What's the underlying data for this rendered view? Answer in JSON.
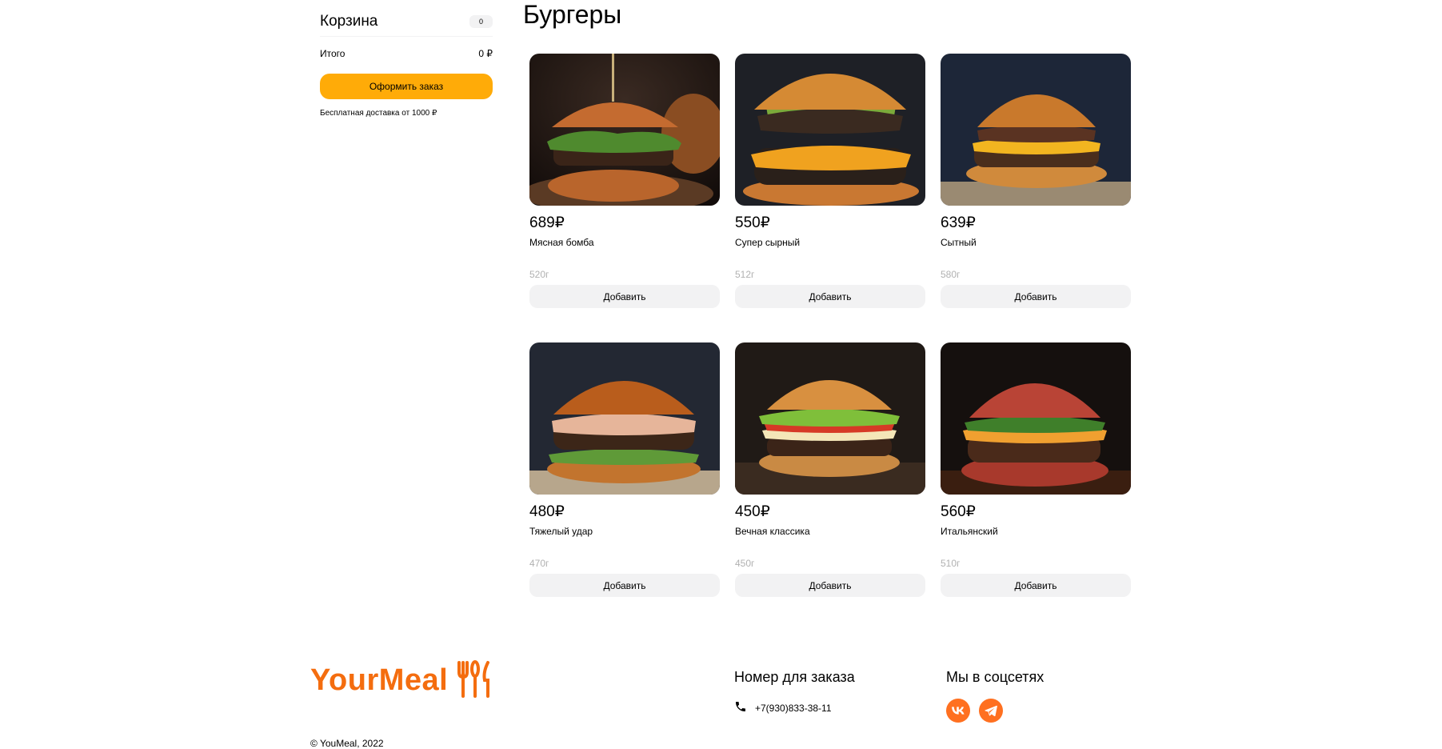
{
  "cart": {
    "title": "Корзина",
    "count": "0",
    "total_label": "Итого",
    "total_value": "0 ₽",
    "order_button": "Оформить заказ",
    "delivery_note": "Бесплатная доставка от 1000 ₽"
  },
  "section": {
    "title": "Бургеры"
  },
  "products": [
    {
      "price": "689₽",
      "name": "Мясная бомба",
      "weight": "520г",
      "button": "Добавить"
    },
    {
      "price": "550₽",
      "name": "Супер сырный",
      "weight": "512г",
      "button": "Добавить"
    },
    {
      "price": "639₽",
      "name": "Сытный",
      "weight": "580г",
      "button": "Добавить"
    },
    {
      "price": "480₽",
      "name": "Тяжелый удар",
      "weight": "470г",
      "button": "Добавить"
    },
    {
      "price": "450₽",
      "name": "Вечная классика",
      "weight": "450г",
      "button": "Добавить"
    },
    {
      "price": "560₽",
      "name": "Итальянский",
      "weight": "510г",
      "button": "Добавить"
    }
  ],
  "footer": {
    "logo": "YourMeal",
    "copyright": "© YouMeal, 2022",
    "phone_heading": "Номер для заказа",
    "phone": "+7(930)833-38-11",
    "social_heading": "Мы в соцсетях",
    "social_icons": [
      "vk-icon",
      "telegram-icon"
    ],
    "accent_color": "#f46d0f",
    "button_color": "#ffab08"
  }
}
